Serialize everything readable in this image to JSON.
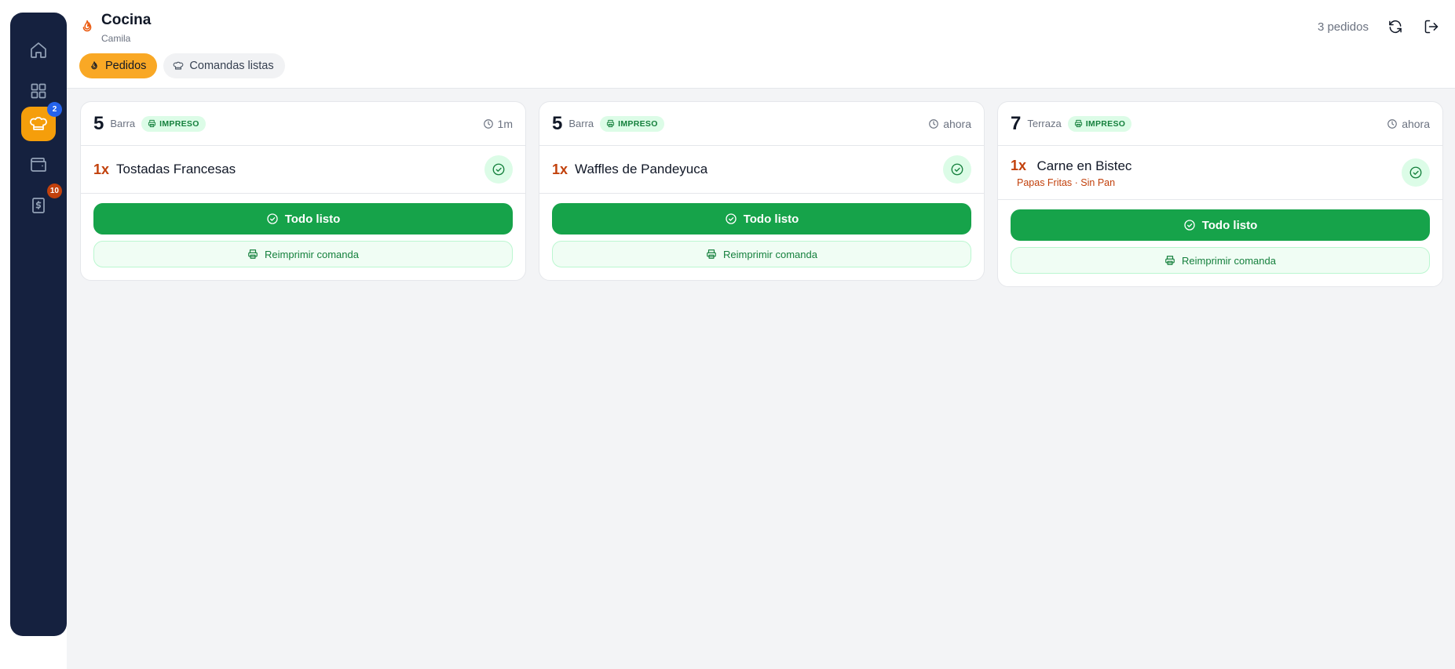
{
  "sidebar": {
    "items": [
      {
        "name": "home",
        "icon": "home-icon"
      },
      {
        "name": "grid",
        "icon": "grid-icon"
      },
      {
        "name": "kitchen",
        "icon": "chef-hat-icon",
        "badge": "2",
        "active": true
      },
      {
        "name": "wallet",
        "icon": "wallet-icon"
      },
      {
        "name": "billing",
        "icon": "receipt-dollar-icon",
        "badge": "10"
      }
    ]
  },
  "header": {
    "title": "Cocina",
    "subtitle": "Camila",
    "order_count": "3 pedidos",
    "tabs": [
      {
        "label": "Pedidos",
        "icon": "flame-icon",
        "active": true
      },
      {
        "label": "Comandas listas",
        "icon": "chef-hat-icon",
        "active": false
      }
    ]
  },
  "orders": [
    {
      "table": "5",
      "zone": "Barra",
      "status": "IMPRESO",
      "time": "1m",
      "items": [
        {
          "qty": "1x",
          "name": "Tostadas Francesas",
          "mods": ""
        }
      ],
      "ready_label": "Todo listo",
      "reprint_label": "Reimprimir comanda"
    },
    {
      "table": "5",
      "zone": "Barra",
      "status": "IMPRESO",
      "time": "ahora",
      "items": [
        {
          "qty": "1x",
          "name": "Waffles de Pandeyuca",
          "mods": ""
        }
      ],
      "ready_label": "Todo listo",
      "reprint_label": "Reimprimir comanda"
    },
    {
      "table": "7",
      "zone": "Terraza",
      "status": "IMPRESO",
      "time": "ahora",
      "items": [
        {
          "qty": "1x",
          "name": "Carne en Bistec",
          "mods": "Papas Fritas · Sin Pan"
        }
      ],
      "ready_label": "Todo listo",
      "reprint_label": "Reimprimir comanda"
    }
  ],
  "colors": {
    "sidebar": "#15213f",
    "accent": "#f9a825",
    "success": "#16a34a",
    "quantity": "#c2410c"
  }
}
